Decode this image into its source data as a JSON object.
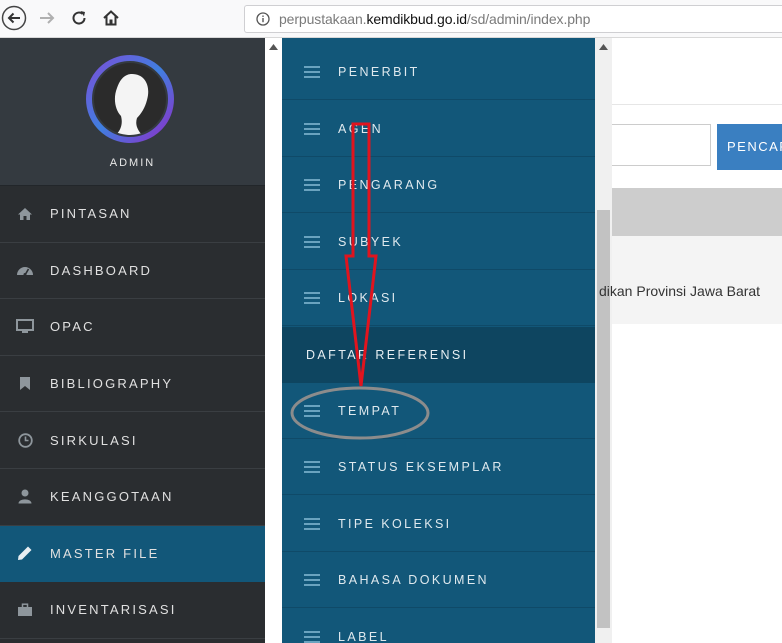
{
  "browser": {
    "url_prefix": "perpustakaan.",
    "url_domain": "kemdikbud.go.id",
    "url_path": "/sd/admin/index.php"
  },
  "sidebar": {
    "profile_name": "ADMIN",
    "items": [
      {
        "label": "PINTASAN",
        "icon": "home-icon"
      },
      {
        "label": "DASHBOARD",
        "icon": "dashboard-icon"
      },
      {
        "label": "OPAC",
        "icon": "monitor-icon"
      },
      {
        "label": "BIBLIOGRAPHY",
        "icon": "bookmark-icon"
      },
      {
        "label": "SIRKULASI",
        "icon": "clock-icon"
      },
      {
        "label": "KEANGGOTAAN",
        "icon": "user-icon"
      },
      {
        "label": "MASTER FILE",
        "icon": "pencil-icon",
        "active": true
      },
      {
        "label": "INVENTARISASI",
        "icon": "briefcase-icon"
      }
    ]
  },
  "submenu": {
    "items_top": [
      "PENERBIT",
      "AGEN",
      "PENGARANG",
      "SUBYEK",
      "LOKASI"
    ],
    "section_header": "DAFTAR REFERENSI",
    "items_bottom": [
      "TEMPAT",
      "STATUS EKSEMPLAR",
      "TIPE KOLEKSI",
      "BAHASA DOKUMEN",
      "LABEL"
    ]
  },
  "main": {
    "search_button": "PENCARIAN",
    "info_text": "dikan Provinsi Jawa Barat"
  },
  "colors": {
    "sidebar_bg": "#2a2d30",
    "submenu_bg": "#125779",
    "active_bg": "#125779",
    "annotation_arrow": "#e0141e",
    "annotation_ellipse": "#8c8c8c"
  }
}
